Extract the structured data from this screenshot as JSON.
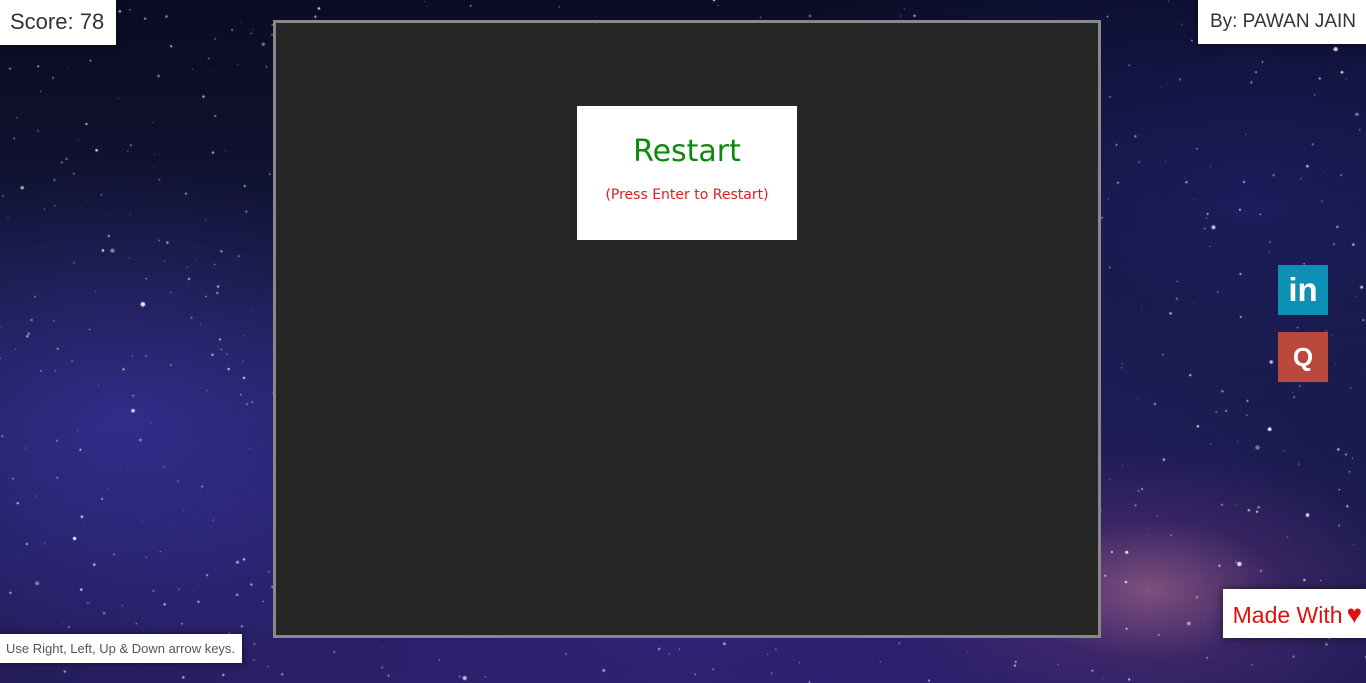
{
  "score": {
    "label": "Score:",
    "value": "78"
  },
  "author": "By: PAWAN JAIN",
  "restart": {
    "title": "Restart",
    "hint": "(Press Enter to Restart)"
  },
  "social": {
    "linkedin": {
      "glyph": "in",
      "icon": "linkedin-icon",
      "color": "#0e8fb4"
    },
    "quora": {
      "glyph": "Q",
      "icon": "quora-icon",
      "color": "#b9493a"
    }
  },
  "footer": {
    "made_with": "Made With",
    "heart": "♥"
  },
  "instructions": "Use Right, Left, Up & Down arrow keys.",
  "colors": {
    "board": "#262626",
    "board_border": "#888888",
    "restart_title": "#0b8a0b",
    "restart_hint": "#e01c1c"
  }
}
